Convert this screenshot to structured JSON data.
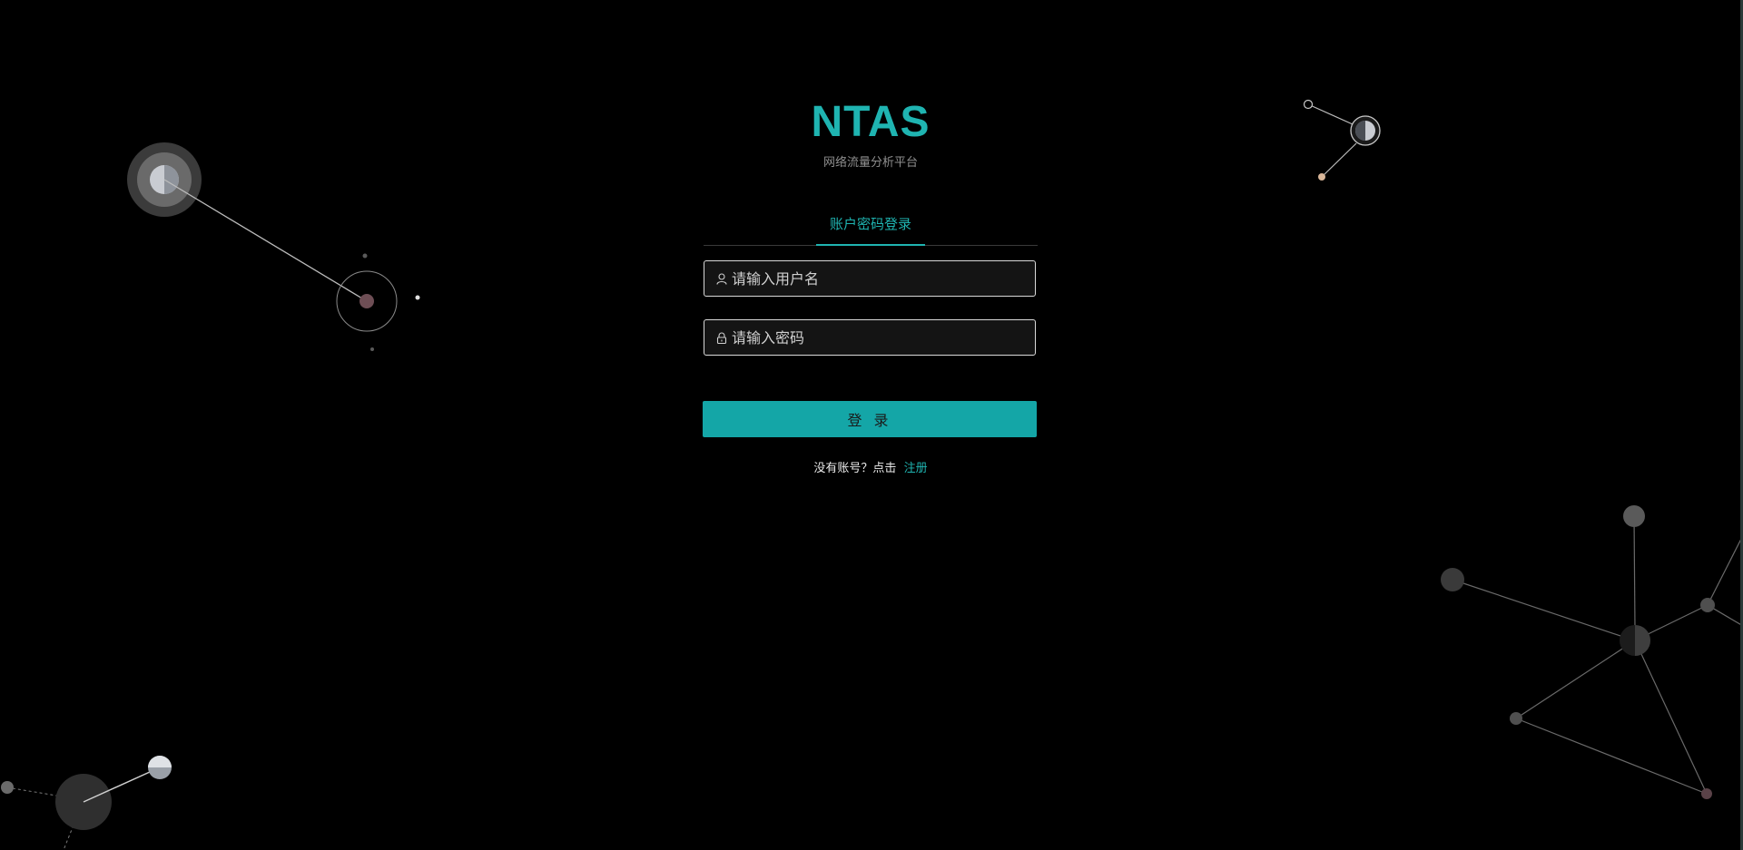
{
  "brand": {
    "title": "NTAS",
    "subtitle": "网络流量分析平台"
  },
  "login": {
    "tab_label": "账户密码登录",
    "username_placeholder": "请输入用户名",
    "password_placeholder": "请输入密码",
    "submit_label": "登 录",
    "register_prompt": "没有账号？点击",
    "register_link": "注册"
  },
  "icons": {
    "username": "user-icon",
    "password": "lock-icon"
  },
  "colors": {
    "background": "#000000",
    "accent": "#1fb4b1",
    "button": "#14a6a7",
    "field_border": "#d9d9d9"
  }
}
